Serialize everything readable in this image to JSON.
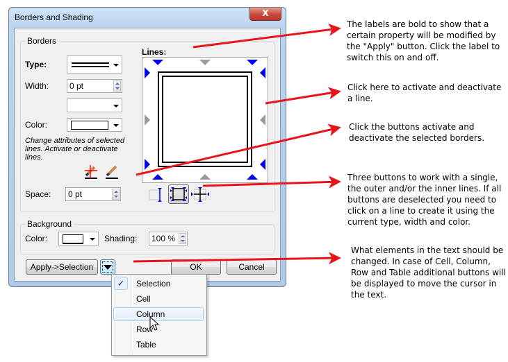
{
  "window": {
    "title": "Borders and Shading",
    "close_label": "X"
  },
  "borders_group": {
    "label": "Borders",
    "type_label": "Type:",
    "width_label": "Width:",
    "width_value": "0 pt",
    "color_label": "Color:",
    "note": "Change attributes of selected lines. Activate or deactivate lines.",
    "space_label": "Space:",
    "space_value": "0 pt",
    "lines_label": "Lines:",
    "icons": {
      "deactivate": "pencil-crossed-icon",
      "activate": "pencil-icon"
    },
    "line_mode_buttons": [
      {
        "name": "single-line",
        "selected": false
      },
      {
        "name": "outer-lines",
        "selected": true
      },
      {
        "name": "inner-lines",
        "selected": false
      }
    ]
  },
  "background_group": {
    "label": "Background",
    "color_label": "Color:",
    "shading_label": "Shading:",
    "shading_value": "100 %"
  },
  "buttons": {
    "apply": "Apply->Selection",
    "ok": "OK",
    "cancel": "Cancel"
  },
  "apply_menu": {
    "items": [
      {
        "label": "Selection",
        "checked": true
      },
      {
        "label": "Cell",
        "checked": false
      },
      {
        "label": "Column",
        "checked": false,
        "hovered": true
      },
      {
        "label": "Row",
        "checked": false
      },
      {
        "label": "Table",
        "checked": false
      }
    ]
  },
  "annotations": [
    "The labels are bold to show that a certain property will be modified by the \"Apply\" button. Click the label to switch this on and off.",
    "Click here to activate and deactivate a line.",
    "Click the buttons activate and deactivate the selected borders.",
    "Three buttons to work with a single, the outer and/or the inner lines. If all buttons are deselected you need to click on a line to create it using the current type, width and color.",
    "What elements in the text should be changed. In case of Cell, Column, Row and Table additional buttons will be displayed to move the cursor in the text."
  ],
  "colors": {
    "arrow": "#e8141c",
    "active_marker": "#0000f0"
  }
}
